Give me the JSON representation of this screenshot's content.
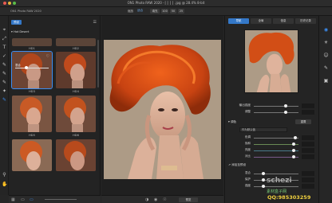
{
  "window": {
    "title": "ON1 Photo RAW 2020 - ▏▏▏▏.jpg @ 28.4% 8-bit",
    "app_label": "ON1 Photo RAW 2020"
  },
  "toolbar": {
    "zoom_label": "缩放",
    "zoom_value": "适合",
    "zoom_buttons": [
      "填充",
      "100",
      "50",
      "25"
    ]
  },
  "browser": {
    "tab_label": "预设",
    "preset_category": "Hot Desert",
    "thumbs": [
      {
        "label": "HD1",
        "fav": false
      },
      {
        "label": "HD2",
        "fav": false
      },
      {
        "label": "HD3",
        "fav": true,
        "selected": true
      },
      {
        "label": "HD4",
        "fav": false
      },
      {
        "label": "HD5",
        "fav": false
      },
      {
        "label": "HD6",
        "fav": false
      }
    ],
    "overlay_label": "混合"
  },
  "center": {
    "preview_label": "预览"
  },
  "right_panel": {
    "tabs": [
      "导航",
      "全局",
      "信息",
      "历史记录"
    ],
    "sliders_top": [
      {
        "label": "输出强度",
        "value": ""
      },
      {
        "label": "调整",
        "value": ""
      }
    ],
    "section_title": "调色",
    "section_button": "重置",
    "dropdown": "作为默认值",
    "sliders_mid": [
      {
        "label": "色调",
        "value": ""
      },
      {
        "label": "饱和",
        "value": ""
      },
      {
        "label": "亮度",
        "value": ""
      },
      {
        "label": "对比",
        "value": ""
      }
    ],
    "section2_title": "↗ 添加至预设",
    "sliders_bottom": [
      {
        "label": "混合",
        "value": ""
      },
      {
        "label": "保护",
        "value": ""
      },
      {
        "label": "强度",
        "value": ""
      }
    ]
  },
  "watermark": {
    "site": "schezi",
    "sub": "素材盒子网",
    "qq": "QQ:985303259"
  }
}
